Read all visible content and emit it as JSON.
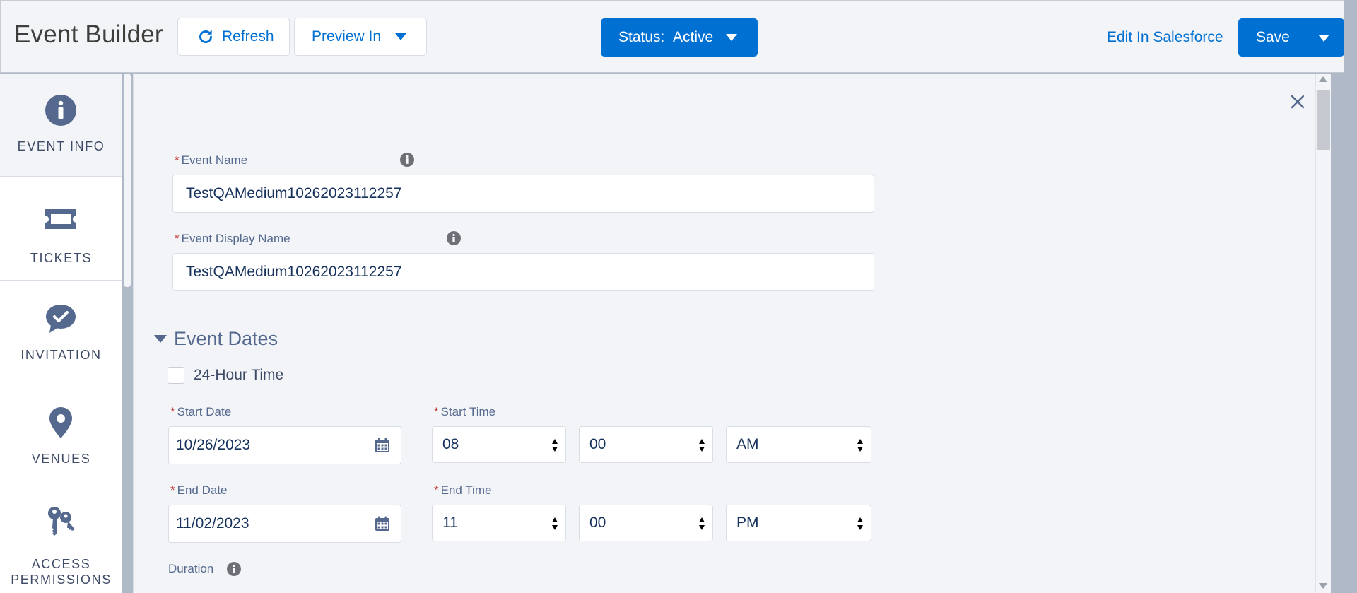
{
  "header": {
    "title": "Event Builder",
    "refresh_label": "Refresh",
    "preview_label": "Preview In",
    "status_prefix": "Status:",
    "status_value": "Active",
    "edit_link": "Edit In Salesforce",
    "save_label": "Save"
  },
  "sidebar": {
    "items": [
      {
        "label": "EVENT INFO",
        "icon": "info-icon",
        "active": true
      },
      {
        "label": "TICKETS",
        "icon": "ticket-icon"
      },
      {
        "label": "INVITATION",
        "icon": "chat-check-icon"
      },
      {
        "label": "VENUES",
        "icon": "location-pin-icon"
      },
      {
        "label": "ACCESS",
        "label2": "PERMISSIONS",
        "icon": "keys-icon"
      }
    ]
  },
  "form": {
    "event_name_label": "Event Name",
    "event_name_value": "TestQAMedium10262023112257",
    "display_name_label": "Event Display Name",
    "display_name_value": "TestQAMedium10262023112257",
    "section_title": "Event Dates",
    "time_format_label": "24-Hour Time",
    "time_format_checked": false,
    "start_date_label": "Start Date",
    "start_date_value": "10/26/2023",
    "start_time_label": "Start Time",
    "start_hour": "08",
    "start_minute": "00",
    "start_ampm": "AM",
    "end_date_label": "End Date",
    "end_date_value": "11/02/2023",
    "end_time_label": "End Time",
    "end_hour": "11",
    "end_minute": "00",
    "end_ampm": "PM",
    "duration_label": "Duration"
  },
  "colors": {
    "brand": "#0070d2",
    "required": "#c23934",
    "icon": "#54698d"
  }
}
